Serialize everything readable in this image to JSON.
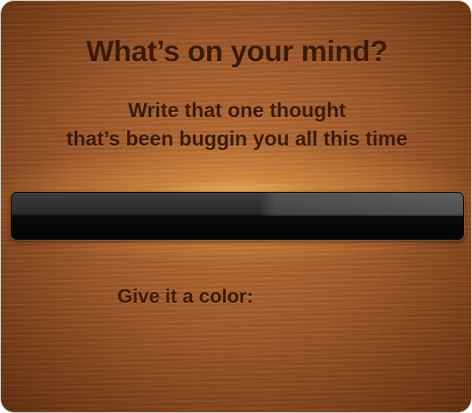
{
  "dialog": {
    "title": "What’s on your mind?",
    "subtitle_line1": "Write that one thought",
    "subtitle_line2": "that’s been buggin you all this time",
    "thought_input": {
      "value": "",
      "placeholder": ""
    },
    "color_label": "Give it a color:"
  },
  "colors": {
    "wood": "#9c5628",
    "text": "#3a1a07",
    "glow": "#ffd678",
    "input_bg": "#0a0a0a"
  }
}
